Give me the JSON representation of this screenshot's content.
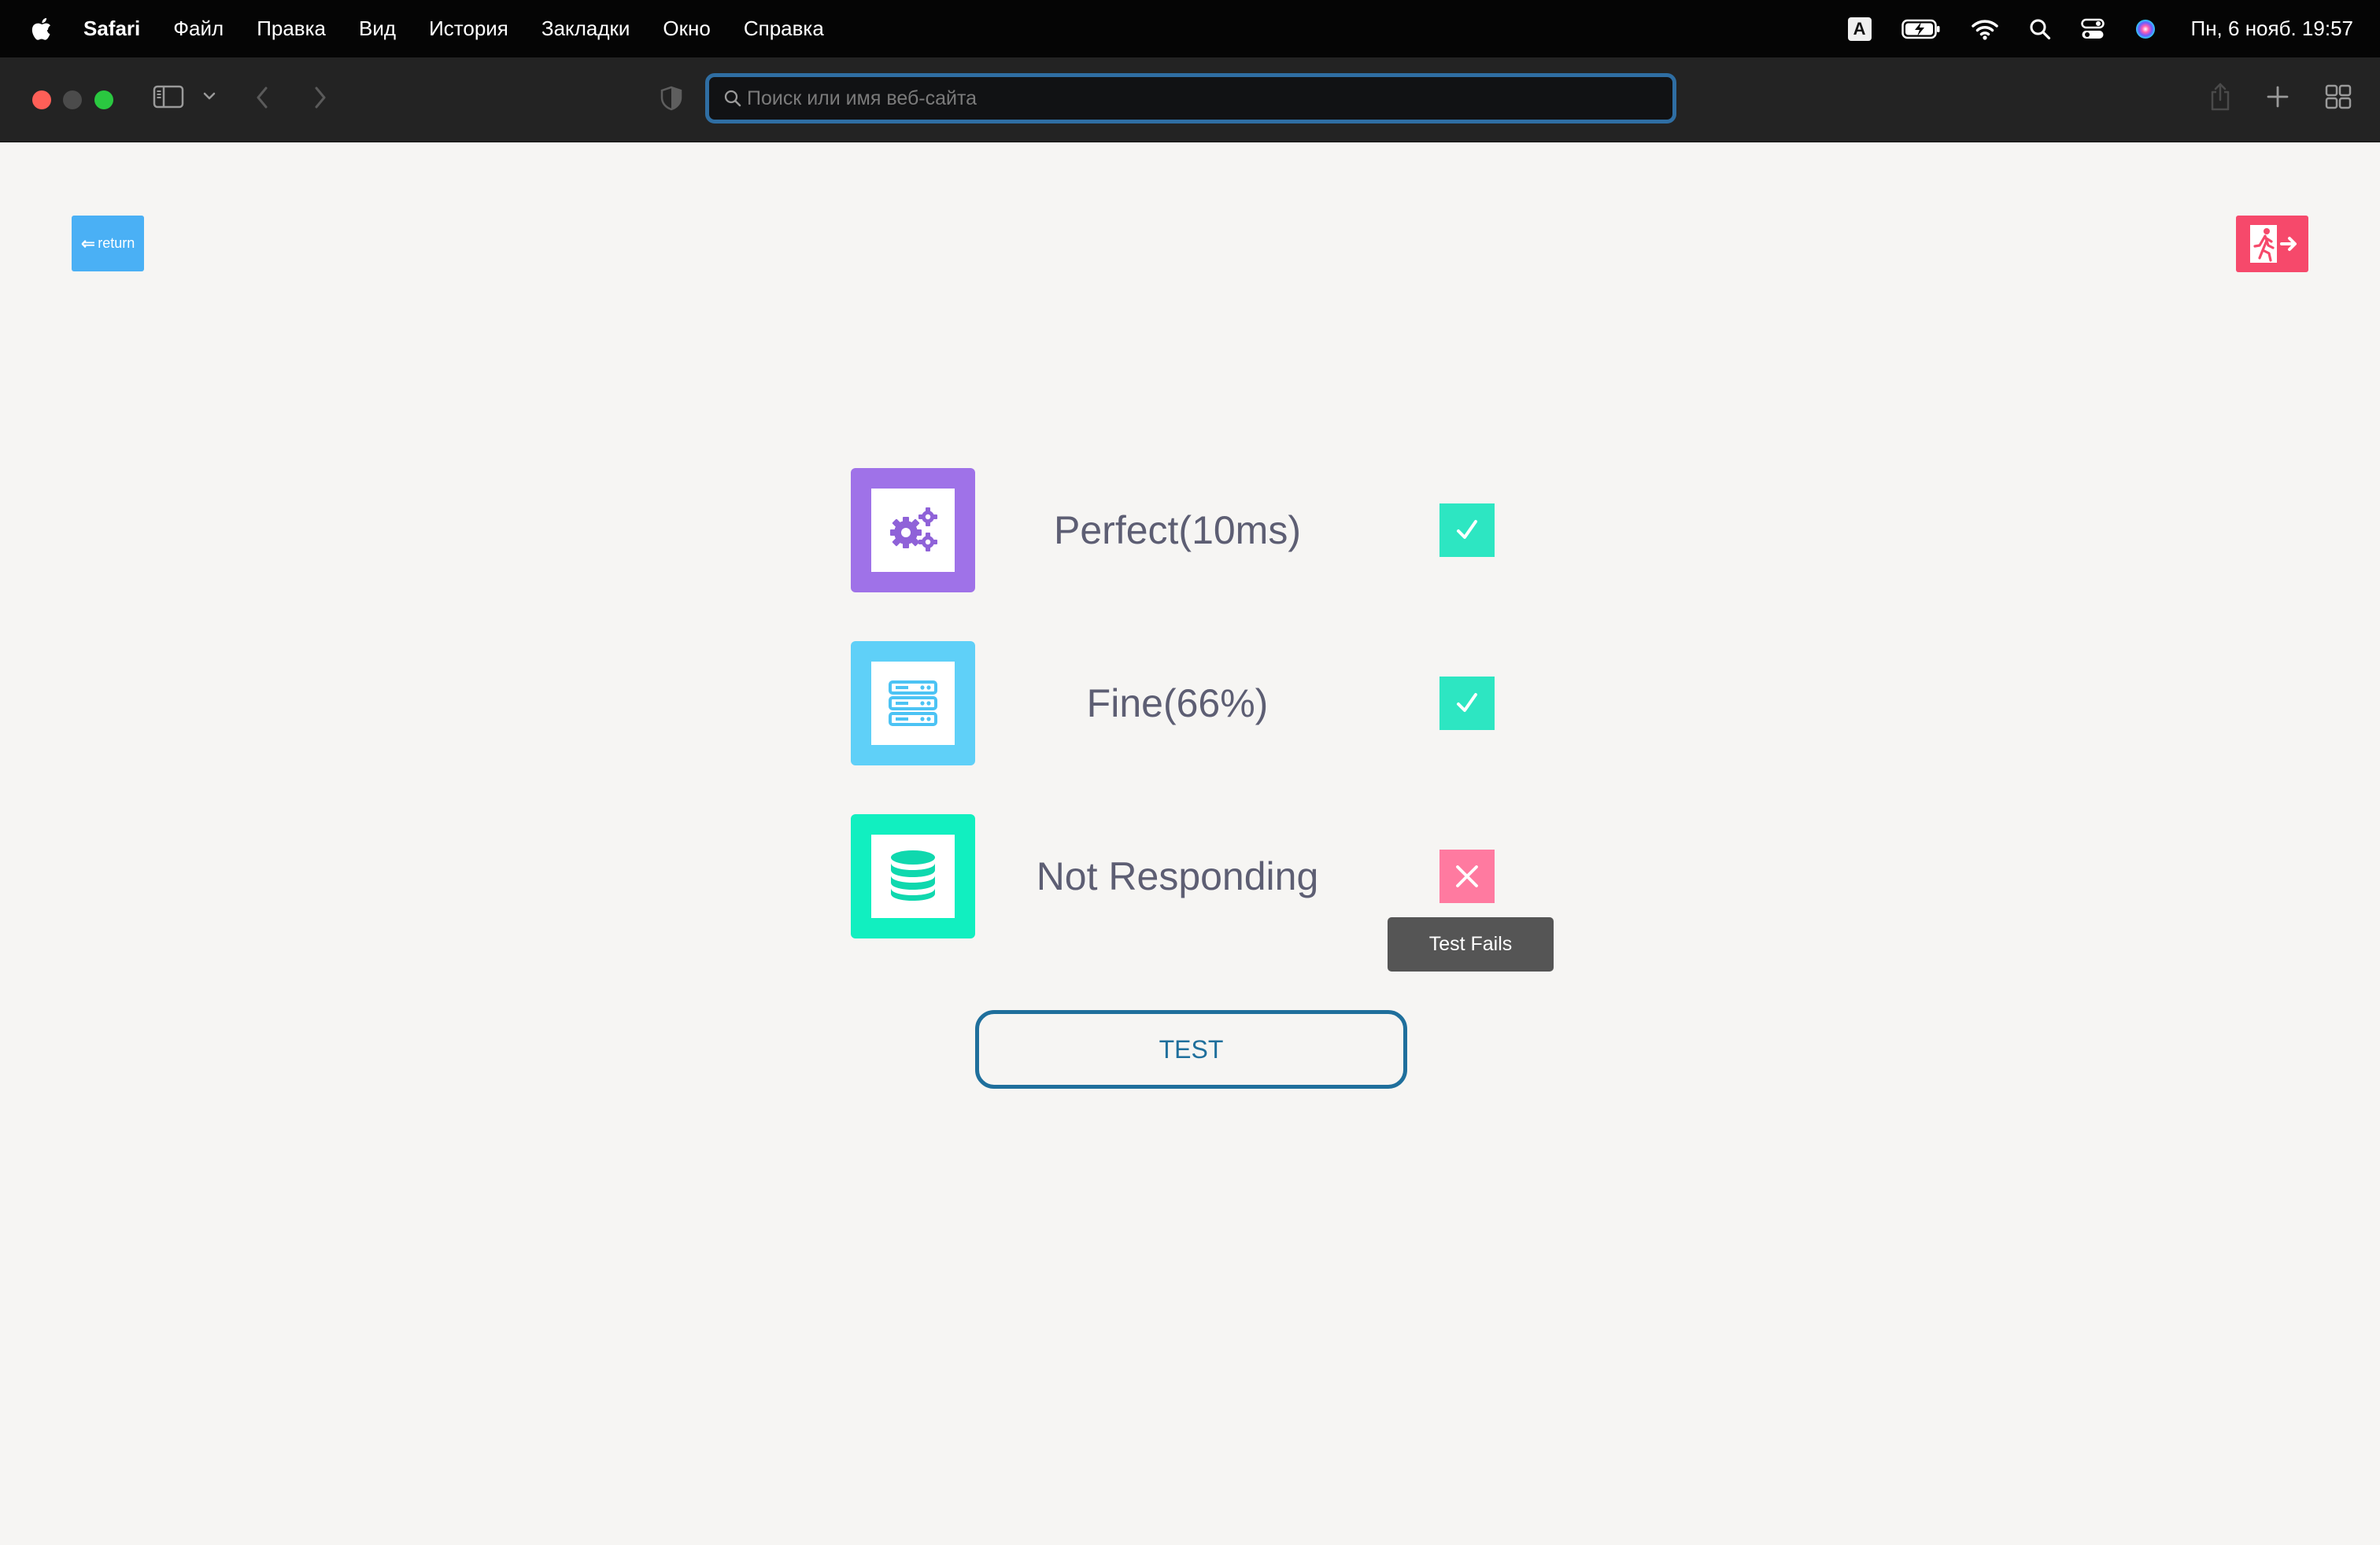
{
  "menubar": {
    "app_name": "Safari",
    "items": [
      "Файл",
      "Правка",
      "Вид",
      "История",
      "Закладки",
      "Окно",
      "Справка"
    ],
    "input_badge": "A",
    "clock": "Пн, 6 нояб.  19:57"
  },
  "toolbar": {
    "address_placeholder": "Поиск или имя веб-сайта"
  },
  "page": {
    "return_label": "return",
    "services": [
      {
        "icon": "gears-icon",
        "label": "Perfect(10ms)",
        "status": "ok",
        "color": "#9f72e8"
      },
      {
        "icon": "server-icon",
        "label": "Fine(66%)",
        "status": "ok",
        "color": "#5fd0f8"
      },
      {
        "icon": "database-icon",
        "label": "Not Responding",
        "status": "fail",
        "color": "#11efc0"
      }
    ],
    "tooltip": "Test Fails",
    "test_button": "TEST"
  },
  "colors": {
    "return_button": "#4ab0f5",
    "exit_button": "#f6496b",
    "status_ok": "#2de6c2",
    "status_fail": "#ff7aa0",
    "test_border": "#1f6f9c"
  }
}
